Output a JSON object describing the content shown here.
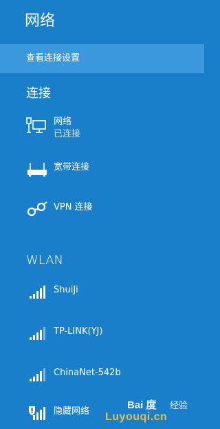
{
  "panel": {
    "title": "网络",
    "settings_link": "查看连接设置"
  },
  "connections": {
    "heading": "连接",
    "items": [
      {
        "name": "网络",
        "status": "已连接",
        "icon": "wired-network-icon"
      },
      {
        "name": "宽带连接",
        "icon": "broadband-modem-icon"
      },
      {
        "name": "VPN 连接",
        "icon": "vpn-link-icon"
      }
    ]
  },
  "wlan": {
    "heading": "WLAN",
    "networks": [
      {
        "name": "ShuiJi",
        "icon": "wifi-signal-icon"
      },
      {
        "name": "TP-LINK(YJ)",
        "icon": "wifi-signal-icon"
      },
      {
        "name": "ChinaNet-542b",
        "icon": "wifi-signal-icon"
      },
      {
        "name": "隐藏网络",
        "icon": "wifi-signal-warning-icon"
      }
    ]
  },
  "watermark": {
    "logo": "Bai 度",
    "logo_suffix": "经验",
    "domain": "Luyouqi.cn"
  },
  "colors": {
    "background": "#1a7fca",
    "highlight_row": "#3b98dc",
    "secondary_text": "#cfe4f5",
    "watermark_domain": "#f8c542"
  }
}
